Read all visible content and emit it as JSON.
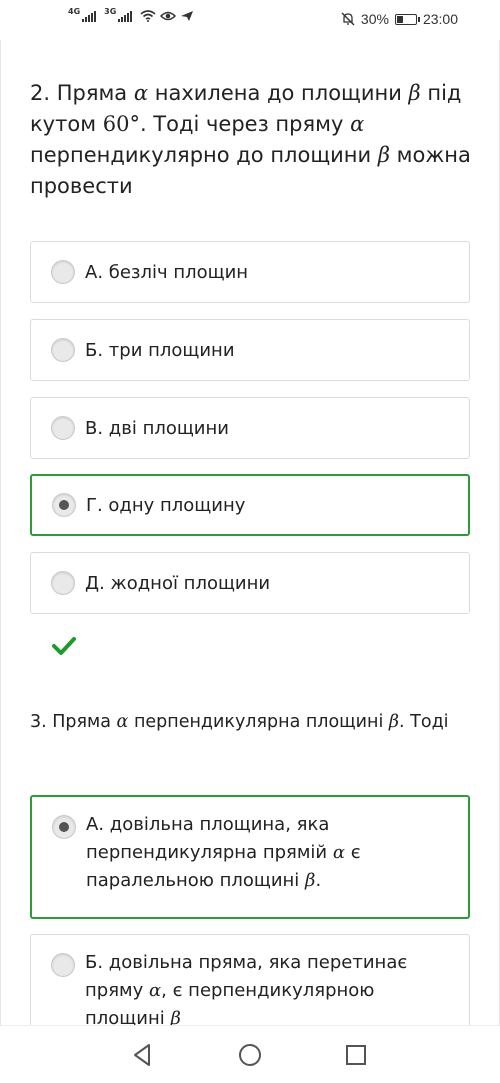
{
  "status_bar": {
    "network_1": "4G",
    "network_2": "3G",
    "battery_percent": "30%",
    "time": "23:00",
    "icons": [
      "signal-icon",
      "signal-icon",
      "wifi-icon",
      "eye-icon",
      "send-icon",
      "mute-icon",
      "battery-icon"
    ]
  },
  "question2": {
    "text_parts": [
      "2. Пряма ",
      "α",
      " нахилена до площини ",
      "β",
      " під кутом ",
      "60°",
      ". Тоді через пряму ",
      "α",
      " перпендикулярно до площини ",
      "β",
      " можна провести"
    ],
    "options": [
      {
        "label": "А. безліч площин",
        "selected": false
      },
      {
        "label": "Б. три площини",
        "selected": false
      },
      {
        "label": "В. дві площини",
        "selected": false
      },
      {
        "label": "Г. одну площину",
        "selected": true
      },
      {
        "label": "Д. жодної площини",
        "selected": false
      }
    ],
    "result_icon": "checkmark-icon",
    "result_color": "#1e9a2c"
  },
  "question3": {
    "text_parts": [
      "3. Пряма ",
      "α",
      " перпендикулярна площині ",
      "β",
      ". Тоді"
    ],
    "options": [
      {
        "label_parts": [
          "А. довільна площина, яка перпендикулярна прямій ",
          "α",
          " є паралельною площині ",
          "β",
          "."
        ],
        "selected": true
      },
      {
        "label_parts": [
          "Б. довільна пряма, яка перетинає пряму ",
          "α",
          ", є перпендикулярною площині ",
          "β"
        ],
        "selected": false
      }
    ]
  },
  "colors": {
    "selected_border": "#2e9a3a",
    "option_border": "#dcdcdc"
  },
  "nav_bar": {
    "icons": [
      "back-icon",
      "home-icon",
      "recents-icon"
    ]
  }
}
